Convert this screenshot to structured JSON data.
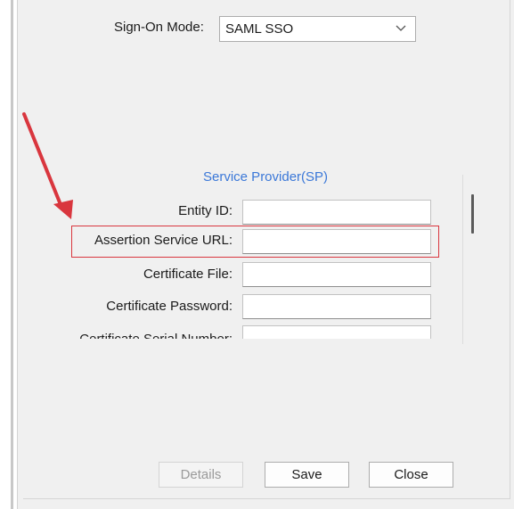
{
  "sign_on": {
    "label": "Sign-On Mode:",
    "selected": "SAML SSO"
  },
  "section": {
    "title": "Service Provider(SP)"
  },
  "fields": [
    {
      "label": "Entity ID:",
      "value": ""
    },
    {
      "label": "Assertion Service URL:",
      "value": ""
    },
    {
      "label": "Certificate File:",
      "value": ""
    },
    {
      "label": "Certificate Password:",
      "value": ""
    },
    {
      "label": "Certificate Serial Number:",
      "value": ""
    }
  ],
  "buttons": {
    "details": "Details",
    "save": "Save",
    "close": "Close"
  },
  "colors": {
    "accent_text": "#3b78d8",
    "highlight": "#d9363e",
    "arrow": "#d9363e"
  },
  "icons": {
    "combo_arrow": "chevron-down-icon",
    "annotation": "red-arrow-icon"
  }
}
